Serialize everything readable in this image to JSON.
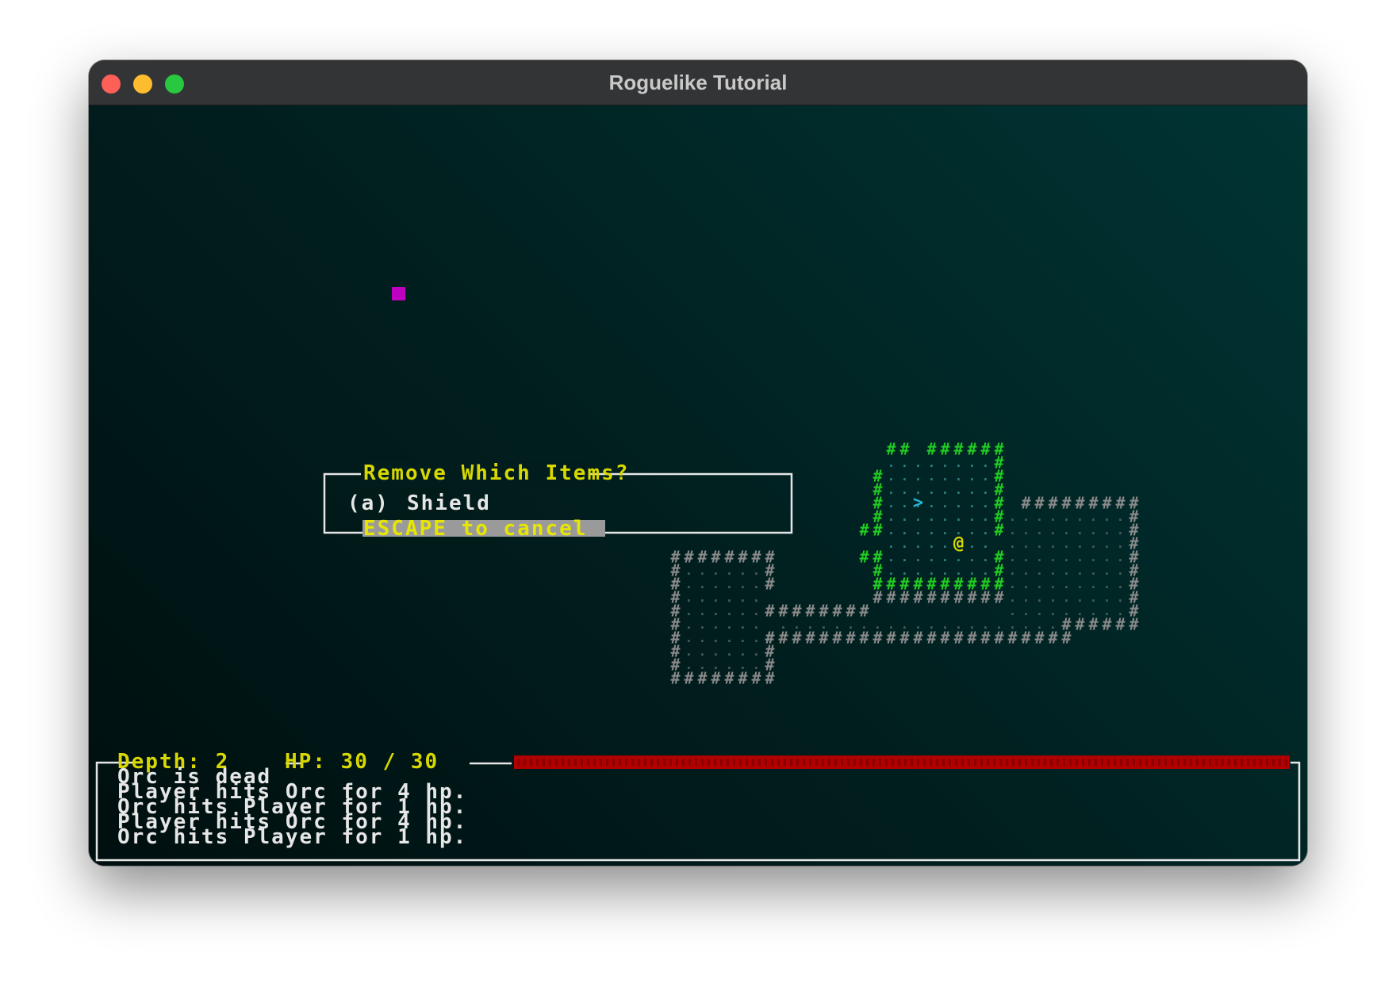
{
  "window": {
    "title": "Roguelike Tutorial"
  },
  "menu": {
    "title": "Remove Which Items?",
    "items": [
      {
        "key": "(a)",
        "label": "Shield"
      }
    ],
    "footer": "ESCAPE to cancel"
  },
  "status": {
    "depth_label": "Depth: 2",
    "hp_label": "HP: 30 / 30",
    "hp_current": 30,
    "hp_max": 30
  },
  "log": [
    "Orc is dead",
    "Player hits Orc for 4 hp.",
    "Orc hits Player for 1 hp.",
    "Player hits Orc for 4 hp.",
    "Orc hits Player for 1 hp."
  ],
  "map": {
    "wall_glyph": "#",
    "floor_glyph": ".",
    "player_glyph": "@",
    "stairs_glyph": ">",
    "colors": {
      "visible_wall": "#22cc22",
      "remembered_wall": "#8a8a8a",
      "visible_floor": "#2e7f7f",
      "remembered_floor": "#4a5a5a",
      "player": "#d8d800",
      "stairs": "#22b8d8",
      "magenta_marker": "#c000c0"
    }
  },
  "ui_colors": {
    "menu_title": "#d8d800",
    "menu_text": "#e6e6e6",
    "menu_footer_text": "#e6e600",
    "menu_footer_bg": "#9a9a9a",
    "status_text": "#d8d800",
    "hp_bar": "#b00000",
    "log_text": "#e6e6e6",
    "frame": "#e6e6e6"
  }
}
